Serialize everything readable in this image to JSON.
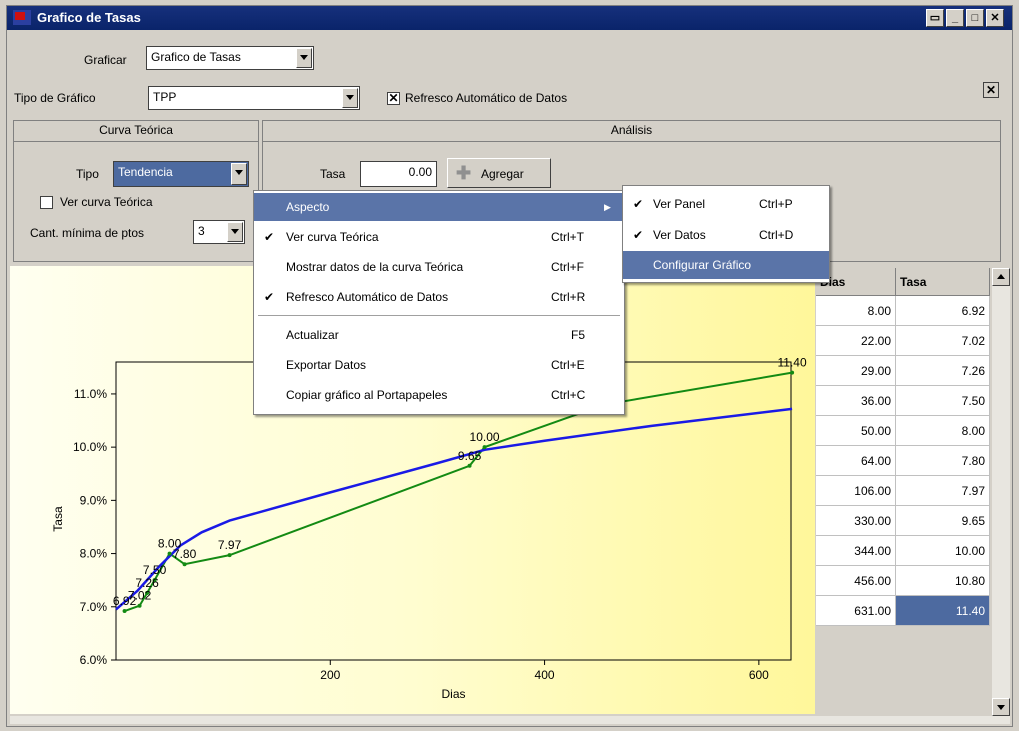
{
  "window": {
    "title": "Grafico de Tasas"
  },
  "form": {
    "graficar_label": "Graficar",
    "graficar_value": "Grafico de Tasas",
    "tipo_grafico_label": "Tipo de Gráfico",
    "tipo_grafico_value": "TPP",
    "refresco_label": "Refresco Automático de Datos"
  },
  "curva": {
    "title": "Curva Teórica",
    "tipo_label": "Tipo",
    "tipo_value": "Tendencia",
    "ver_label": "Ver curva Teórica",
    "cant_label": "Cant. mínima de ptos",
    "cant_value": "3"
  },
  "analisis": {
    "title": "Análisis",
    "tasa_label": "Tasa",
    "tasa_value": "0.00",
    "agregar_label": "Agregar"
  },
  "context_menu": {
    "items": [
      {
        "label": "Aspecto",
        "shortcut": ""
      },
      {
        "label": "Ver curva Teórica",
        "shortcut": "Ctrl+T",
        "checked": true
      },
      {
        "label": "Mostrar datos de la curva Teórica",
        "shortcut": "Ctrl+F"
      },
      {
        "label": "Refresco Automático de Datos",
        "shortcut": "Ctrl+R",
        "checked": true
      },
      {
        "label": "Actualizar",
        "shortcut": "F5"
      },
      {
        "label": "Exportar Datos",
        "shortcut": "Ctrl+E"
      },
      {
        "label": "Copiar gráfico al Portapapeles",
        "shortcut": "Ctrl+C"
      }
    ]
  },
  "submenu": {
    "items": [
      {
        "label": "Ver Panel",
        "shortcut": "Ctrl+P",
        "checked": true
      },
      {
        "label": "Ver Datos",
        "shortcut": "Ctrl+D",
        "checked": true
      },
      {
        "label": "Configurar Gráfico",
        "shortcut": ""
      }
    ]
  },
  "table": {
    "headers": [
      "Dias",
      "Tasa"
    ],
    "rows": [
      [
        "8.00",
        "6.92"
      ],
      [
        "22.00",
        "7.02"
      ],
      [
        "29.00",
        "7.26"
      ],
      [
        "36.00",
        "7.50"
      ],
      [
        "50.00",
        "8.00"
      ],
      [
        "64.00",
        "7.80"
      ],
      [
        "106.00",
        "7.97"
      ],
      [
        "330.00",
        "9.65"
      ],
      [
        "344.00",
        "10.00"
      ],
      [
        "456.00",
        "10.80"
      ],
      [
        "631.00",
        "11.40"
      ]
    ]
  },
  "chart_data": {
    "type": "line",
    "xlabel": "Dias",
    "ylabel": "Tasa",
    "xlim": [
      0,
      630
    ],
    "ylim": [
      6.0,
      11.6
    ],
    "xticks": [
      "200",
      "400",
      "600"
    ],
    "yticks": [
      "6.0%",
      "7.0%",
      "8.0%",
      "9.0%",
      "10.0%",
      "11.0%"
    ],
    "series": [
      {
        "color": "#138a13",
        "x": [
          8,
          22,
          29,
          36,
          50,
          64,
          106,
          330,
          344,
          456,
          631
        ],
        "y": [
          6.92,
          7.02,
          7.26,
          7.5,
          8.0,
          7.8,
          7.97,
          9.65,
          10.0,
          10.8,
          11.4
        ]
      },
      {
        "color": "#1a1ae6",
        "x": [
          0,
          20,
          40,
          60,
          80,
          106,
          200,
          300,
          344,
          400,
          500,
          631
        ],
        "y": [
          6.95,
          7.3,
          7.75,
          8.15,
          8.4,
          8.62,
          9.15,
          9.7,
          9.95,
          10.12,
          10.4,
          10.72
        ]
      }
    ],
    "point_labels": [
      {
        "x": 8,
        "y": 6.92,
        "text": "6.92"
      },
      {
        "x": 22,
        "y": 7.02,
        "text": "7.02"
      },
      {
        "x": 29,
        "y": 7.26,
        "text": "7.26"
      },
      {
        "x": 36,
        "y": 7.5,
        "text": "7.50"
      },
      {
        "x": 50,
        "y": 8.0,
        "text": "8.00"
      },
      {
        "x": 64,
        "y": 7.8,
        "text": "7.80"
      },
      {
        "x": 106,
        "y": 7.97,
        "text": "7.97"
      },
      {
        "x": 330,
        "y": 9.65,
        "text": "9.65"
      },
      {
        "x": 344,
        "y": 10.0,
        "text": "10.00"
      },
      {
        "x": 631,
        "y": 11.4,
        "text": "11.40"
      }
    ]
  }
}
